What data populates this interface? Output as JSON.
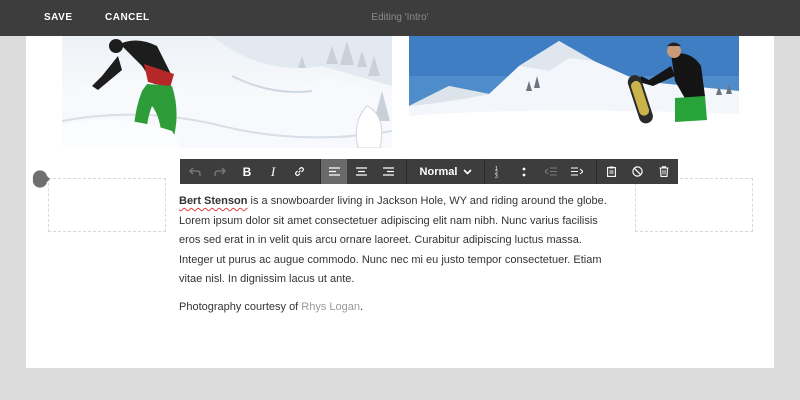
{
  "topbar": {
    "save_label": "SAVE",
    "cancel_label": "CANCEL",
    "title": "Editing 'Intro'"
  },
  "toolbar": {
    "text_style": "Normal",
    "icons": [
      "undo-icon",
      "redo-icon",
      "bold-icon",
      "italic-icon",
      "link-icon",
      "align-left-icon",
      "align-center-icon",
      "align-right-icon",
      "chevron-down-icon",
      "ordered-list-icon",
      "unordered-list-icon",
      "outdent-icon",
      "indent-icon",
      "paste-icon",
      "clear-format-icon",
      "trash-icon"
    ],
    "active_color": "#6a6a6a",
    "bar_color": "#3d3d3d"
  },
  "content": {
    "name": "Bert Stenson",
    "paragraph": " is a snowboarder living in Jackson Hole, WY and riding around the globe. Lorem ipsum dolor sit amet consectetuer adipiscing elit nam nibh. Nunc varius facilisis eros sed erat in in velit quis arcu ornare laoreet. Curabitur adipiscing luctus massa. Integer ut purus ac augue commodo. Nunc nec mi eu justo tempor consectetuer. Etiam vitae nisl. In dignissim lacus ut ante.",
    "credit_prefix": "Photography courtesy of ",
    "credit_link": "Rhys Logan",
    "credit_suffix": "."
  },
  "images": [
    "snowboarder-in-deep-snow-photo",
    "snowboarder-holding-board-photo"
  ]
}
